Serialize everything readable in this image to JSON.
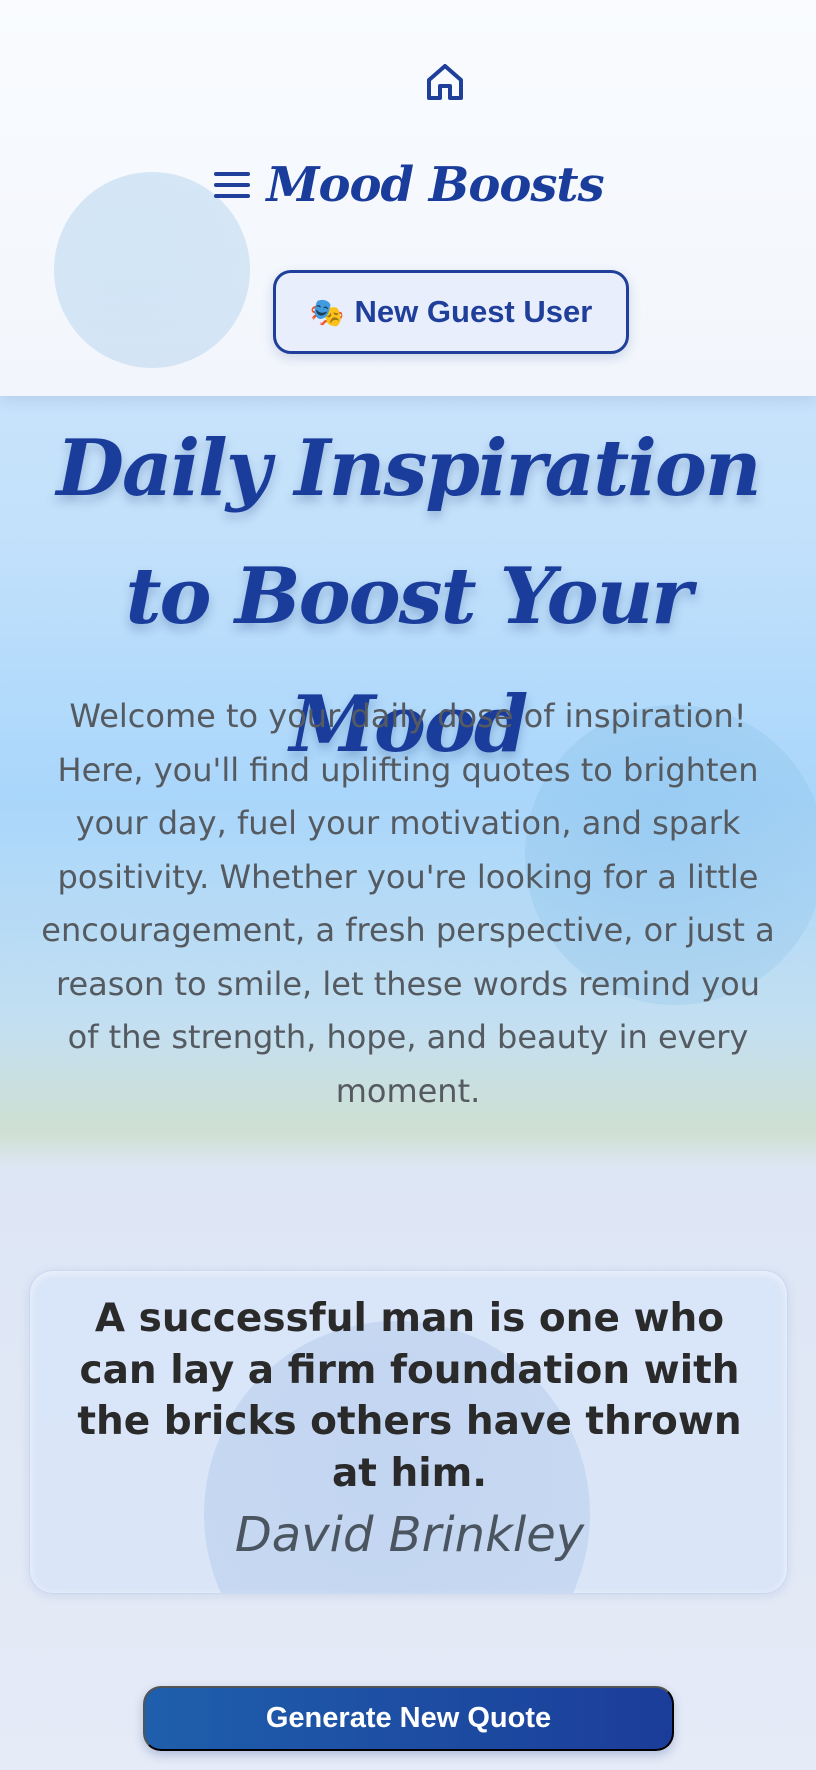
{
  "header": {
    "home_icon": "home-icon",
    "menu_icon": "hamburger-menu-icon",
    "brand": "Mood Boosts",
    "guest_button": {
      "icon": "🎭",
      "label": "New Guest User"
    }
  },
  "hero": {
    "title": "Daily Inspiration to Boost Your Mood",
    "text": "Welcome to your daily dose of inspiration! Here, you'll find uplifting quotes to brighten your day, fuel your motivation, and spark positivity. Whether you're looking for a little encouragement, a fresh perspective, or just a reason to smile, let these words remind you of the strength, hope, and beauty in every moment."
  },
  "quote": {
    "text": "A successful man is one who can lay a firm foundation with the bricks others have thrown at him.",
    "author": "David Brinkley"
  },
  "actions": {
    "generate_label": "Generate New Quote"
  },
  "colors": {
    "brand": "#1a3d9c",
    "button_gradient_start": "#1f5fac",
    "button_gradient_end": "#1b3d9a"
  }
}
